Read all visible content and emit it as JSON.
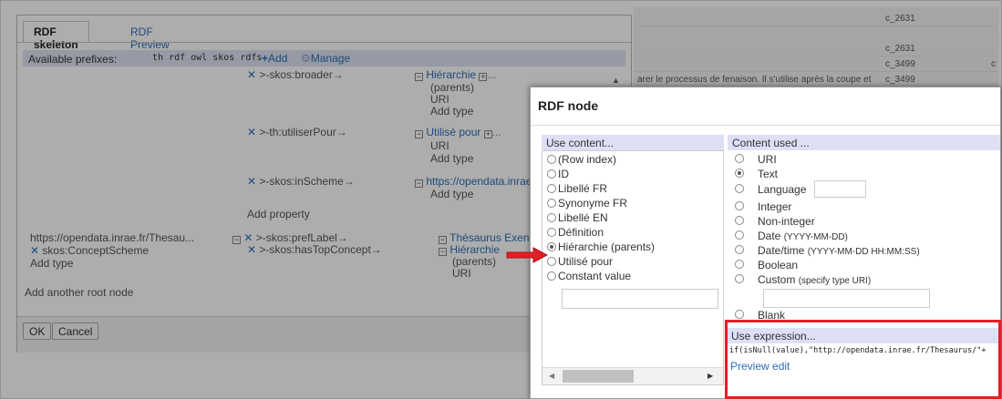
{
  "background_rows": [
    {
      "text": "c_2631",
      "right": ""
    },
    {
      "text": "c_2631",
      "right": ""
    },
    {
      "text": "c_3499",
      "right": "c"
    },
    {
      "text": "c_3499",
      "right": ""
    }
  ],
  "background_sentence": "arer le processus de fenaison. Il s'utilise après la coupe et",
  "skeleton": {
    "tabs": [
      "RDF skeleton",
      "RDF Preview"
    ],
    "prefix_label": "Available prefixes:",
    "prefixes": "th rdf owl skos rdfs",
    "add_label": "Add",
    "manage_label": "Manage",
    "properties": [
      {
        "prop": "skos:broader→",
        "target": "Hiérarchie",
        "target2": "(parents)",
        "uri": "URI",
        "add_type": "Add type",
        "dots": "..."
      },
      {
        "prop": "th:utiliserPour→",
        "target": "Utilisé pour",
        "uri": "URI",
        "add_type": "Add type",
        "dots": "..."
      },
      {
        "prop": "skos:inScheme→",
        "target": "https://opendata.inrae",
        "add_type": "Add type"
      }
    ],
    "add_property": "Add property",
    "root2": {
      "uri": "https://opendata.inrae.fr/Thesau...",
      "type": "skos:ConceptScheme",
      "add_type": "Add type",
      "prop1": "skos:prefLabel→",
      "prop2": "skos:hasTopConcept→",
      "target1": "Thésaurus Exen",
      "target2a": "Hiérarchie",
      "target2b": "(parents)",
      "target2c": "URI"
    },
    "add_root": "Add another root node",
    "ok": "OK",
    "cancel": "Cancel"
  },
  "node": {
    "title": "RDF node",
    "use_content": "Use content...",
    "content_used": "Content used ...",
    "content_options": [
      {
        "label": "(Row index)",
        "checked": false
      },
      {
        "label": "ID",
        "checked": false
      },
      {
        "label": "Libellé FR",
        "checked": false
      },
      {
        "label": "Synonyme FR",
        "checked": false
      },
      {
        "label": "Libellé EN",
        "checked": false
      },
      {
        "label": "Définition",
        "checked": false
      },
      {
        "label": "Hiérarchie (parents)",
        "checked": true
      },
      {
        "label": "Utilisé pour",
        "checked": false
      },
      {
        "label": "Constant value",
        "checked": false
      }
    ],
    "type_options": [
      {
        "label": "URI",
        "hint": "",
        "checked": false
      },
      {
        "label": "Text",
        "hint": "",
        "checked": true
      },
      {
        "label": "Language",
        "hint": "",
        "checked": false
      },
      {
        "label": "Integer",
        "hint": "",
        "checked": false
      },
      {
        "label": "Non-integer",
        "hint": "",
        "checked": false
      },
      {
        "label": "Date",
        "hint": "(YYYY-MM-DD)",
        "checked": false
      },
      {
        "label": "Date/time",
        "hint": "(YYYY-MM-DD HH:MM:SS)",
        "checked": false
      },
      {
        "label": "Boolean",
        "hint": "",
        "checked": false
      },
      {
        "label": "Custom",
        "hint": "(specify type URI)",
        "checked": false
      },
      {
        "label": "Blank",
        "hint": "",
        "checked": false
      }
    ],
    "use_expression": "Use expression...",
    "expression": "if(isNull(value),\"http://opendata.inrae.fr/Thesaurus/\"+",
    "preview_edit": "Preview edit"
  },
  "colors": {
    "highlight": "#e21f26",
    "link": "#2e6db4",
    "column_header": "#dde0f5"
  }
}
